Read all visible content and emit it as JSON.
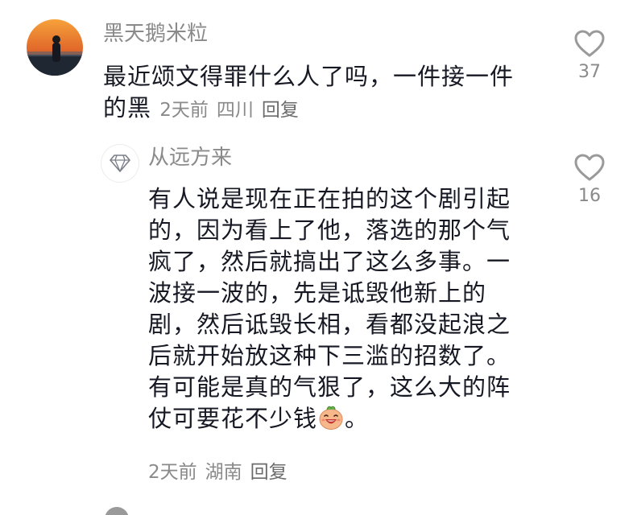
{
  "comment_main": {
    "username": "黑天鹅米粒",
    "lines": [
      "最近颂文得罪什么人了吗，一件接一件",
      "的黑"
    ],
    "time": "2天前",
    "location": "四川",
    "reply_label": "回复",
    "likes": "37"
  },
  "comment_reply": {
    "username": "从远方来",
    "lines": [
      "有人说是现在正在拍的这个剧引起",
      "的，因为看上了他，落选的那个气",
      "疯了，然后就搞出了这么多事。一",
      "波接一波的，先是诋毁他新上的",
      "剧，然后诋毁长相，看都没起浪之",
      "后就开始放这种下三滥的招数了。",
      "有可能是真的气狠了，这么大的阵",
      "仗可要花不少钱"
    ],
    "line_end": "。",
    "time": "2天前",
    "location": "湖南",
    "reply_label": "回复",
    "likes": "16"
  },
  "icons": {
    "like": "heart-outline-icon",
    "reply_avatar": "diamond-icon",
    "emoji": "laughing-face-emoji"
  },
  "colors": {
    "text": "#161823",
    "meta": "#8a8a8a",
    "icon": "#9a9a9a"
  }
}
